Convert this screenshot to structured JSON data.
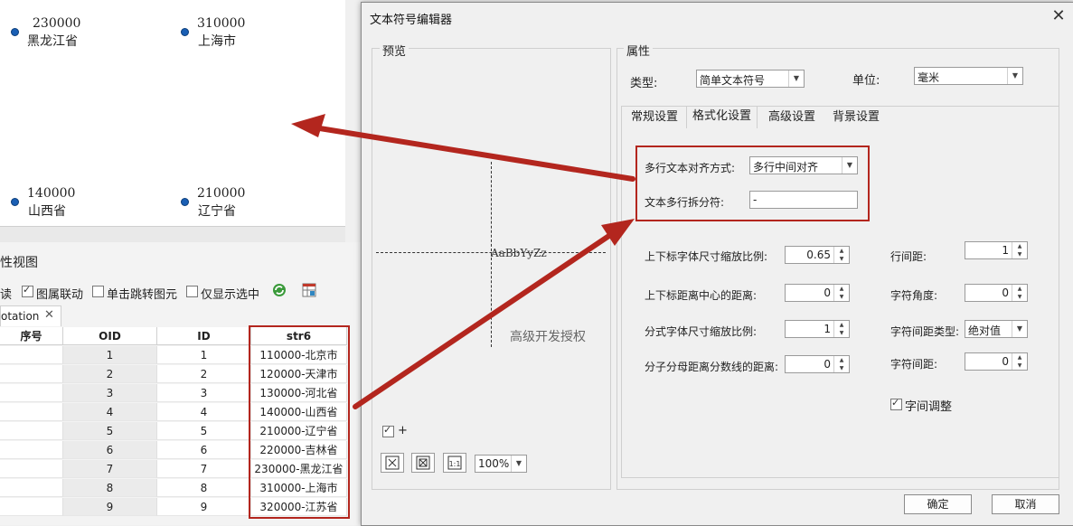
{
  "map": {
    "points": [
      {
        "code": "230000",
        "name": "黑龙江省"
      },
      {
        "code": "310000",
        "name": "上海市"
      },
      {
        "code": "140000",
        "name": "山西省"
      },
      {
        "code": "210000",
        "name": "辽宁省"
      }
    ]
  },
  "attribute_view": {
    "title": "性视图",
    "toolbar": {
      "readonly_label": "读",
      "layer_link_label": "图属联动",
      "click_jump_label": "单击跳转图元",
      "show_selected_label": "仅显示选中"
    },
    "tab_label": "otation",
    "columns": [
      "序号",
      "OID",
      "ID",
      "str6"
    ],
    "rows": [
      {
        "oid": "1",
        "id": "1",
        "str6": "110000-北京市"
      },
      {
        "oid": "2",
        "id": "2",
        "str6": "120000-天津市"
      },
      {
        "oid": "3",
        "id": "3",
        "str6": "130000-河北省"
      },
      {
        "oid": "4",
        "id": "4",
        "str6": "140000-山西省"
      },
      {
        "oid": "5",
        "id": "5",
        "str6": "210000-辽宁省"
      },
      {
        "oid": "6",
        "id": "6",
        "str6": "220000-吉林省"
      },
      {
        "oid": "7",
        "id": "7",
        "str6": "230000-黑龙江省"
      },
      {
        "oid": "8",
        "id": "8",
        "str6": "310000-上海市"
      },
      {
        "oid": "9",
        "id": "9",
        "str6": "320000-江苏省"
      }
    ]
  },
  "dialog": {
    "title": "文本符号编辑器",
    "preview": {
      "group_label": "预览",
      "sample_text": "AaBbYyZz",
      "watermark": "高级开发授权",
      "plus_label": "+",
      "zoom": "100%"
    },
    "properties": {
      "group_label": "属性",
      "type_label": "类型:",
      "type_value": "简单文本符号",
      "unit_label": "单位:",
      "unit_value": "毫米",
      "tabs": [
        "常规设置",
        "格式化设置",
        "高级设置",
        "背景设置"
      ],
      "multiline_align_label": "多行文本对齐方式:",
      "multiline_align_value": "多行中间对齐",
      "multiline_split_label": "文本多行拆分符:",
      "multiline_split_value": "-",
      "fields_left": [
        {
          "label": "上下标字体尺寸缩放比例:",
          "value": "0.65"
        },
        {
          "label": "上下标距离中心的距离:",
          "value": "0"
        },
        {
          "label": "分式字体尺寸缩放比例:",
          "value": "1"
        },
        {
          "label": "分子分母距离分数线的距离:",
          "value": "0"
        }
      ],
      "line_spacing_label": "行间距:",
      "line_spacing_value": "1",
      "char_angle_label": "字符角度:",
      "char_angle_value": "0",
      "char_spacing_type_label": "字符间距类型:",
      "char_spacing_type_value": "绝对值",
      "char_spacing_label": "字符间距:",
      "char_spacing_value": "0",
      "kerning_label": "字间调整"
    },
    "ok_label": "确定",
    "cancel_label": "取消"
  },
  "colors": {
    "annotation_red": "#b3261e",
    "map_point": "#1a5fb4"
  }
}
